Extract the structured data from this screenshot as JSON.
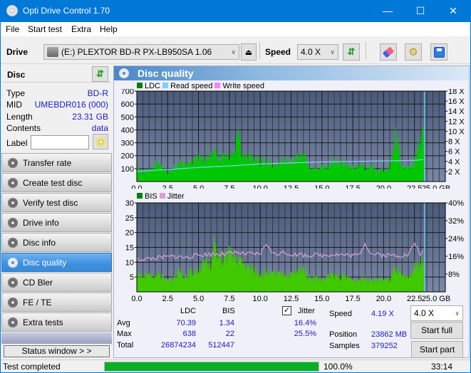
{
  "window": {
    "title": "Opti Drive Control 1.70",
    "minimize": "—",
    "maximize": "☐",
    "close": "✕"
  },
  "menu": [
    {
      "label": "File"
    },
    {
      "label": "Start test"
    },
    {
      "label": "Extra"
    },
    {
      "label": "Help"
    }
  ],
  "toolbar": {
    "drive_label": "Drive",
    "drive_value": "(E:)  PLEXTOR BD-R  PX-LB950SA 1.06",
    "speed_label": "Speed",
    "speed_value": "4.0 X"
  },
  "disc": {
    "header": "Disc",
    "fields": [
      {
        "key": "Type",
        "value": "BD-R"
      },
      {
        "key": "MID",
        "value": "UMEBDR016 (000)"
      },
      {
        "key": "Length",
        "value": "23.31 GB"
      },
      {
        "key": "Contents",
        "value": "data"
      }
    ],
    "label_key": "Label",
    "label_value": ""
  },
  "nav": [
    {
      "label": "Transfer rate",
      "active": false
    },
    {
      "label": "Create test disc",
      "active": false
    },
    {
      "label": "Verify test disc",
      "active": false
    },
    {
      "label": "Drive info",
      "active": false
    },
    {
      "label": "Disc info",
      "active": false
    },
    {
      "label": "Disc quality",
      "active": true
    },
    {
      "label": "CD Bler",
      "active": false
    },
    {
      "label": "FE / TE",
      "active": false
    },
    {
      "label": "Extra tests",
      "active": false
    }
  ],
  "status_window_label": "Status window > >",
  "panel": {
    "title": "Disc quality"
  },
  "colors": {
    "plot_bg_top": "#4a5a7a",
    "plot_bg_bottom": "#7a88a8",
    "ldc": "#00c800",
    "bis": "#40c800",
    "read_speed": "#80d0ff",
    "jitter": "#d8a0d8",
    "write_speed": "#ff80ff",
    "progress": "#06b025",
    "value_text": "#1a1acc"
  },
  "chart_data": [
    {
      "type": "area",
      "title": "LDC / Read speed",
      "legend": [
        {
          "name": "LDC",
          "color": "#008000"
        },
        {
          "name": "Read speed",
          "color": "#80d0ff"
        },
        {
          "name": "Write speed",
          "color": "#ff80ff"
        }
      ],
      "xlabel": "GB",
      "xlim": [
        0,
        25
      ],
      "x_ticks": [
        "0.0",
        "2.5",
        "5.0",
        "7.5",
        "10.0",
        "12.5",
        "15.0",
        "17.5",
        "20.0",
        "22.5",
        "25.0 GB"
      ],
      "ylim_left": [
        0,
        700
      ],
      "y_ticks_left": [
        "100",
        "200",
        "300",
        "400",
        "500",
        "600",
        "700"
      ],
      "ylim_right": [
        0,
        18
      ],
      "y_ticks_right": [
        "2 X",
        "4 X",
        "6 X",
        "8 X",
        "10 X",
        "12 X",
        "14 X",
        "16 X",
        "18 X"
      ],
      "grid": true,
      "series": [
        {
          "name": "LDC",
          "x": [
            0,
            0.5,
            1,
            1.5,
            2,
            2.5,
            3,
            3.5,
            4,
            4.5,
            5,
            5.5,
            6,
            6.5,
            7,
            7.5,
            8,
            8.2,
            8.5,
            9,
            9.5,
            10,
            10.5,
            11,
            11.5,
            12,
            12.5,
            13,
            13.5,
            14,
            14.5,
            15,
            15.5,
            16,
            16.5,
            17,
            17.5,
            18,
            18.5,
            19,
            19.5,
            20,
            20.5,
            21,
            21.5,
            22,
            22.5,
            23,
            23.31
          ],
          "values": [
            130,
            90,
            120,
            160,
            150,
            85,
            140,
            170,
            150,
            190,
            210,
            230,
            240,
            250,
            260,
            270,
            280,
            630,
            270,
            230,
            210,
            190,
            180,
            170,
            160,
            200,
            180,
            220,
            250,
            140,
            130,
            120,
            140,
            200,
            180,
            150,
            130,
            140,
            130,
            120,
            110,
            115,
            120,
            450,
            150,
            120,
            200,
            420,
            450
          ]
        },
        {
          "name": "Read speed",
          "axis": "right",
          "x": [
            0,
            2.5,
            5,
            7.5,
            10,
            12.5,
            15,
            17.5,
            20,
            22.5,
            23.31
          ],
          "values": [
            2.0,
            2.4,
            2.8,
            3.1,
            3.5,
            3.7,
            3.9,
            4.0,
            4.1,
            4.2,
            4.4
          ]
        }
      ],
      "end_marker_x": 23.31
    },
    {
      "type": "area",
      "title": "BIS / Jitter",
      "legend": [
        {
          "name": "BIS",
          "color": "#008000"
        },
        {
          "name": "Jitter",
          "color": "#d8a0d8"
        }
      ],
      "xlabel": "GB",
      "xlim": [
        0,
        25
      ],
      "x_ticks": [
        "0.0",
        "2.5",
        "5.0",
        "7.5",
        "10.0",
        "12.5",
        "15.0",
        "17.5",
        "20.0",
        "22.5",
        "25.0 GB"
      ],
      "ylim_left": [
        0,
        30
      ],
      "y_ticks_left": [
        "5",
        "10",
        "15",
        "20",
        "25",
        "30"
      ],
      "ylim_right": [
        0,
        40
      ],
      "y_ticks_right": [
        "8%",
        "16%",
        "24%",
        "32%",
        "40%"
      ],
      "grid": true,
      "series": [
        {
          "name": "BIS",
          "x": [
            0,
            0.5,
            1,
            1.5,
            2,
            2.5,
            3,
            3.5,
            4,
            4.5,
            5,
            5.5,
            6,
            6.2,
            6.5,
            7,
            7.5,
            8,
            8.5,
            9,
            9.5,
            10,
            10.5,
            11,
            11.5,
            12,
            12.5,
            13,
            13.5,
            14,
            14.5,
            15,
            15.5,
            16,
            16.5,
            17,
            17.5,
            18,
            18.5,
            19,
            19.5,
            20,
            20.5,
            21,
            21.5,
            22,
            22.5,
            23,
            23.31
          ],
          "values": [
            8,
            6,
            8,
            6,
            7,
            5,
            6,
            8,
            7,
            8,
            10,
            11,
            12,
            22,
            13,
            14,
            15,
            14,
            12,
            10,
            9,
            8,
            8,
            7,
            7,
            8,
            7,
            8,
            10,
            6,
            6,
            5,
            6,
            7,
            6,
            6,
            5,
            5,
            6,
            5,
            5,
            5,
            5,
            10,
            6,
            5,
            10,
            12,
            14
          ]
        },
        {
          "name": "Jitter",
          "axis": "right",
          "x": [
            0,
            1,
            2,
            3,
            4,
            5,
            6,
            7,
            8,
            9,
            10,
            10.5,
            11,
            12,
            12.5,
            13,
            14,
            15,
            16,
            17,
            18,
            18.5,
            19,
            20,
            21,
            22,
            22.5,
            23,
            23.31
          ],
          "values": [
            14.5,
            15,
            15.5,
            16,
            15.5,
            16.5,
            17,
            17,
            17.5,
            17,
            17,
            22,
            17,
            17.5,
            17,
            16.5,
            16.5,
            16.5,
            17,
            16.5,
            16.5,
            22,
            17,
            16.5,
            16.5,
            16.5,
            22,
            17,
            18
          ]
        }
      ],
      "end_marker_x": 23.31
    }
  ],
  "stats": {
    "col_ldc": "LDC",
    "col_bis": "BIS",
    "jitter_label": "Jitter",
    "jitter_checked": true,
    "rows": [
      {
        "label": "Avg",
        "ldc": "70.39",
        "bis": "1.34",
        "jitter": "16.4%"
      },
      {
        "label": "Max",
        "ldc": "638",
        "bis": "22",
        "jitter": "25.5%"
      },
      {
        "label": "Total",
        "ldc": "26874234",
        "bis": "512447",
        "jitter": ""
      }
    ],
    "speed_label": "Speed",
    "speed_value": "4.19 X",
    "position_label": "Position",
    "position_value": "23862 MB",
    "samples_label": "Samples",
    "samples_value": "379252",
    "speed_select": "4.0 X",
    "start_full": "Start full",
    "start_part": "Start part"
  },
  "status": {
    "text": "Test completed",
    "progress_percent": 100.0,
    "progress_label": "100.0%",
    "elapsed": "33:14"
  }
}
